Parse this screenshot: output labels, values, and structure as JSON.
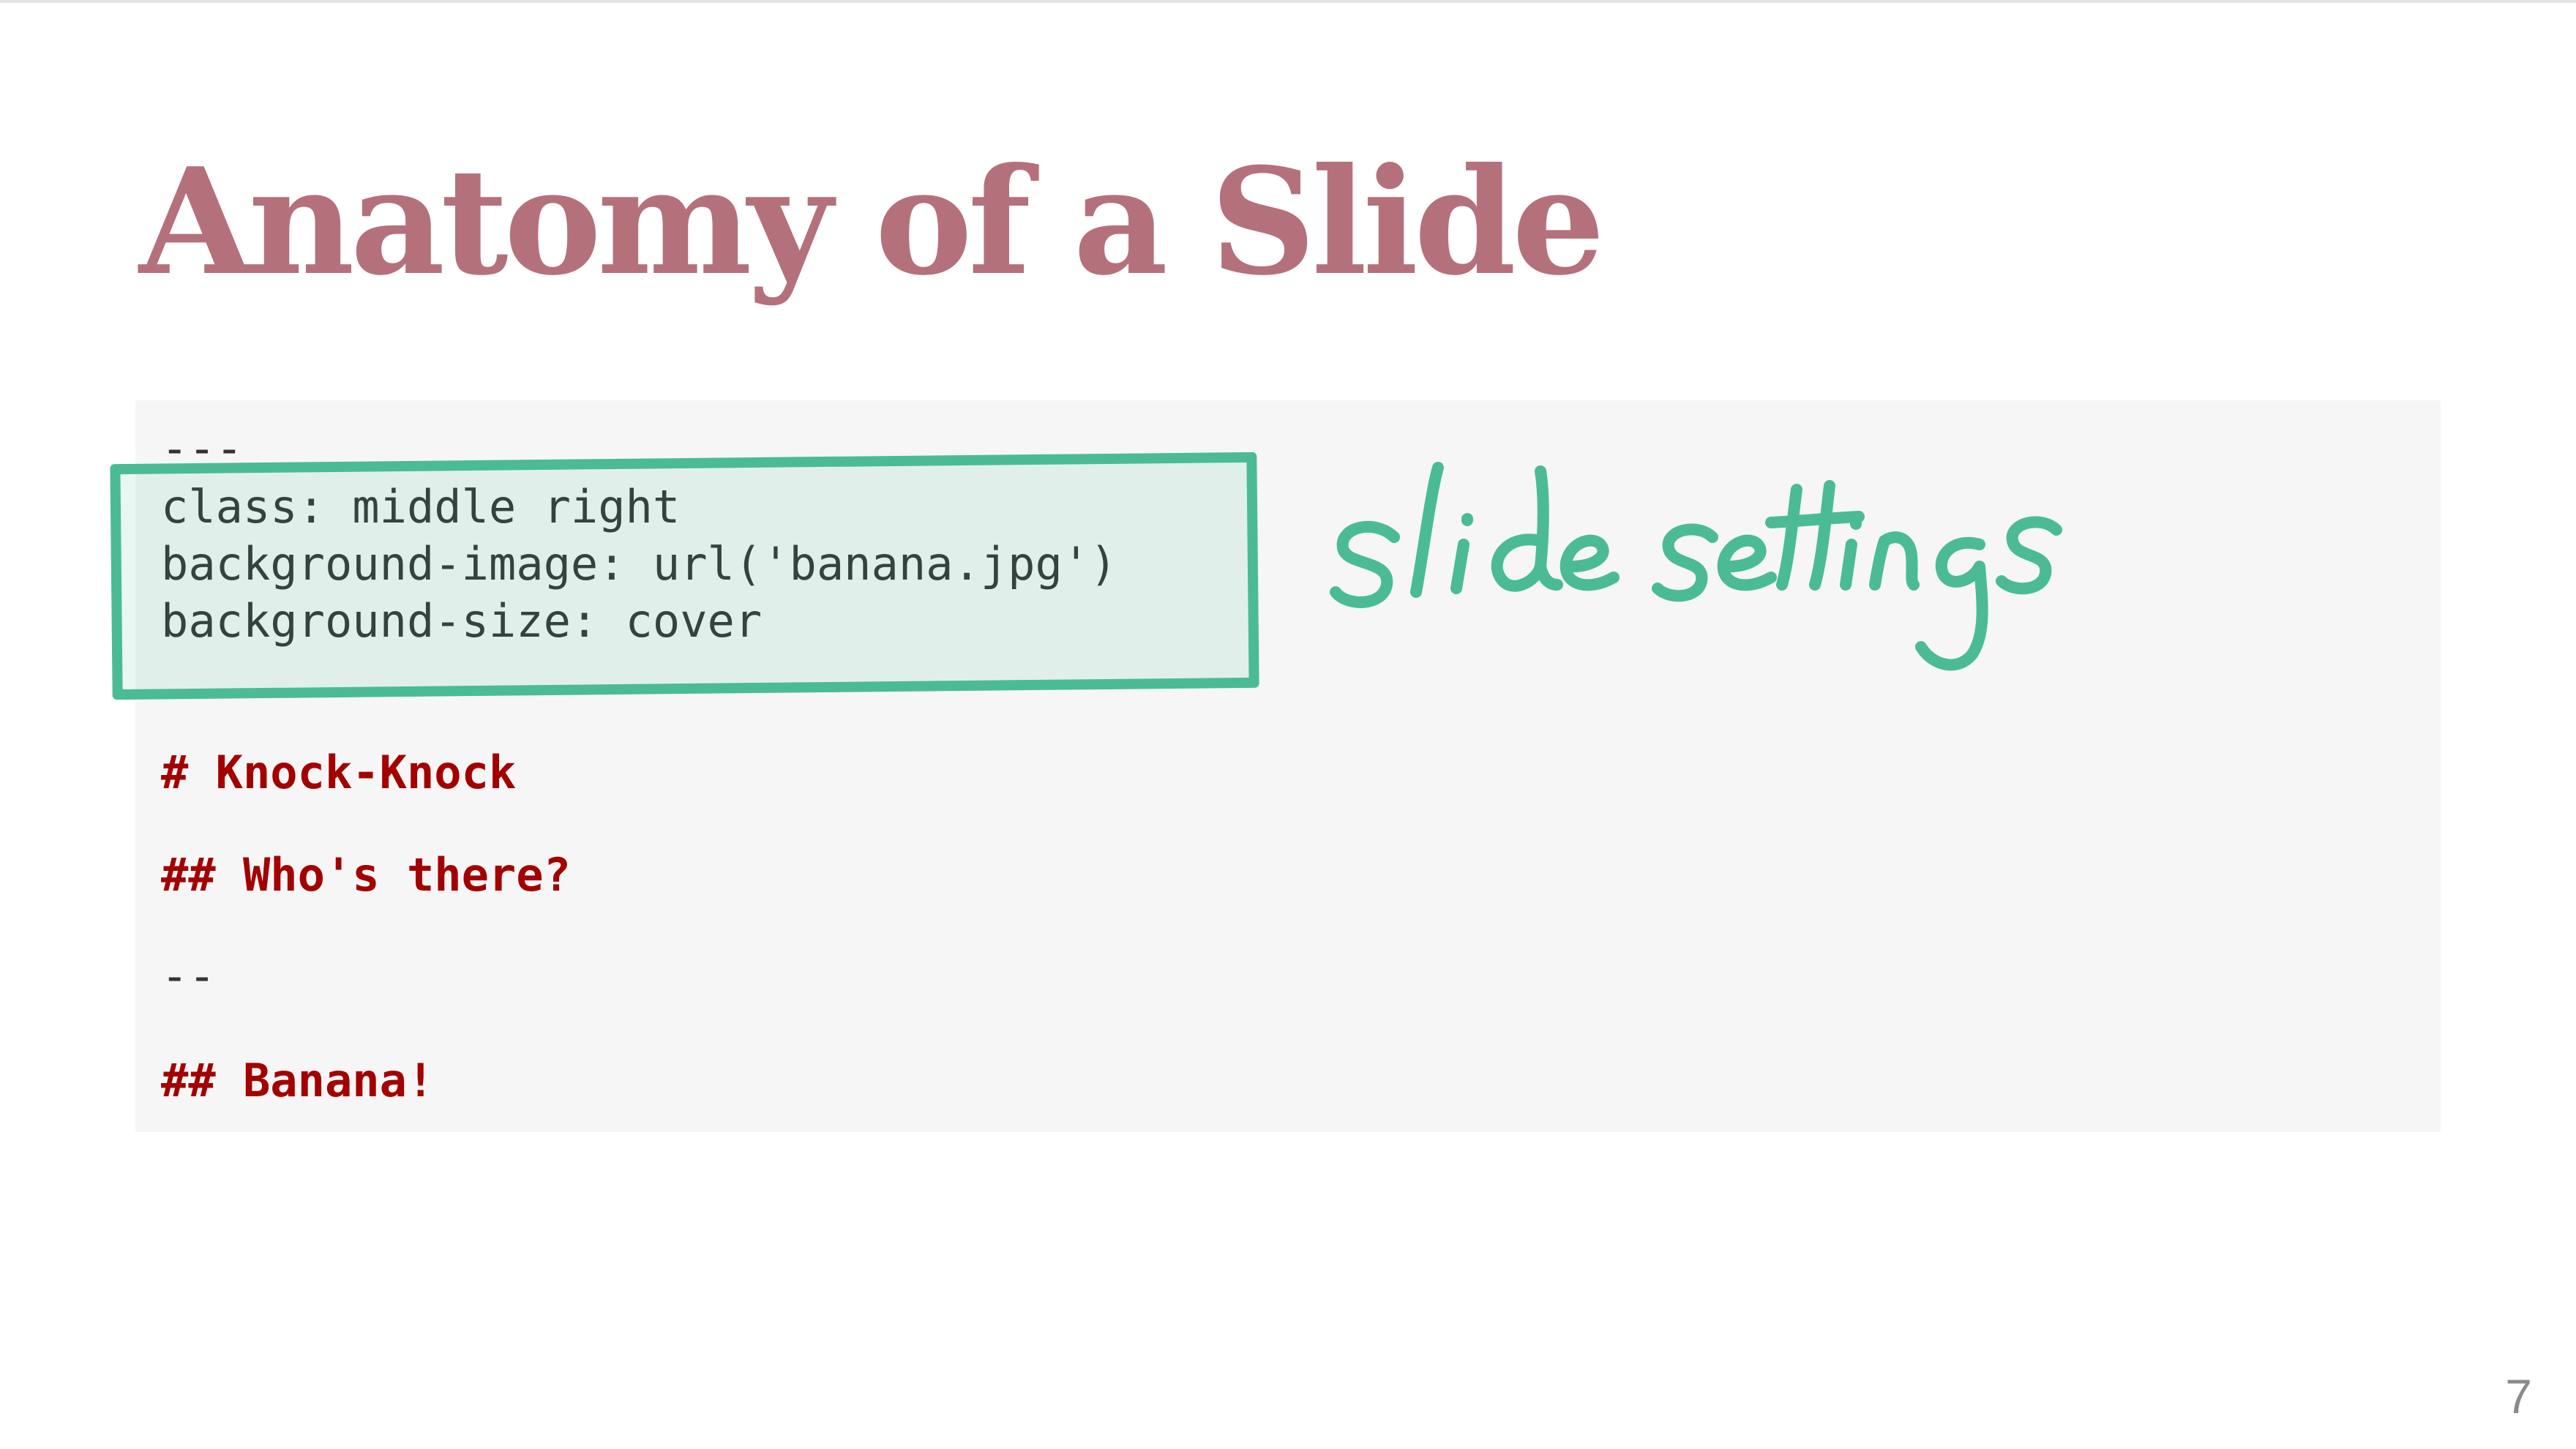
{
  "slide": {
    "title": "Anatomy of a Slide",
    "page_number": "7"
  },
  "code": {
    "lines": [
      "---",
      "class: middle right",
      "background-image: url('banana.jpg')",
      "background-size: cover",
      "# Knock-Knock",
      "## Who's there?",
      "--",
      "## Banana!"
    ]
  },
  "annotation": {
    "text": "slide settings",
    "color": "#4bbb96"
  },
  "colors": {
    "title": "#b5717b",
    "markdown_heading": "#a30000",
    "code_text": "#333333",
    "code_background": "#f6f6f6"
  }
}
